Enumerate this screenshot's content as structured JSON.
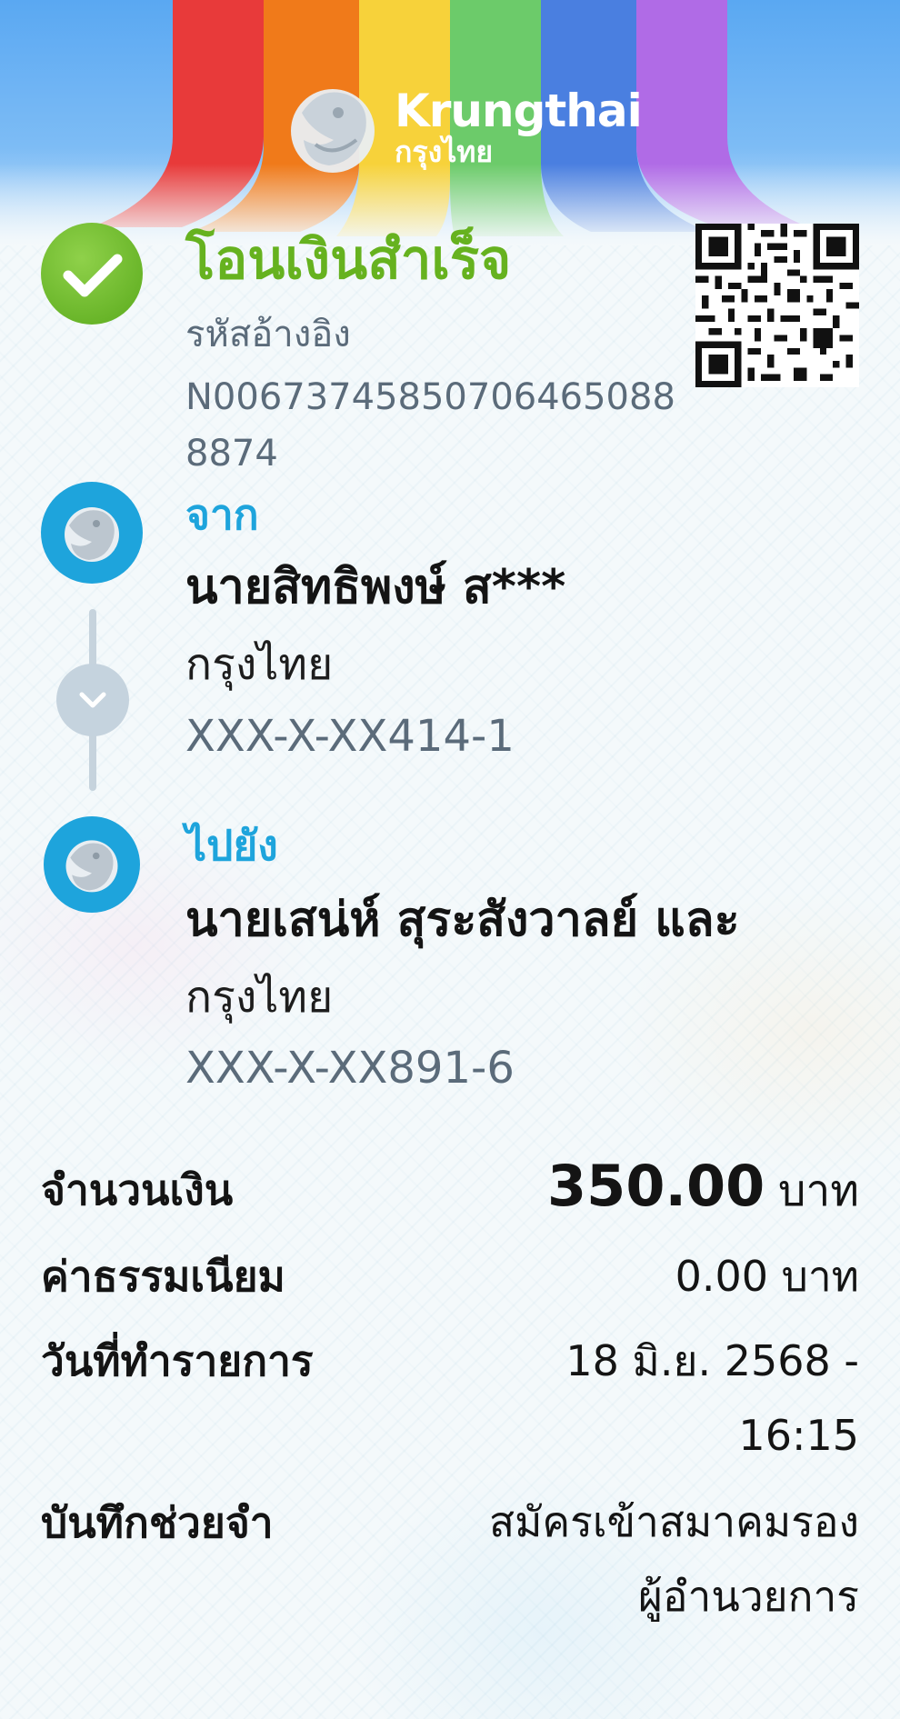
{
  "brand": {
    "name_en": "Krungthai",
    "name_th": "กรุงไทย"
  },
  "status": {
    "title": "โอนเงินสำเร็จ",
    "ref_label": "รหัสอ้างอิง",
    "ref_number": "N006737458507064650888874"
  },
  "from": {
    "label": "จาก",
    "name": "นายสิทธิพงษ์ ส***",
    "bank": "กรุงไทย",
    "account": "XXX-X-XX414-1"
  },
  "to": {
    "label": "ไปยัง",
    "name": "นายเสน่ห์ สุระสังวาลย์ และ",
    "bank": "กรุงไทย",
    "account": "XXX-X-XX891-6"
  },
  "details": {
    "amount_label": "จำนวนเงิน",
    "amount_value": "350.00",
    "amount_unit": "บาท",
    "fee_label": "ค่าธรรมเนียม",
    "fee_value": "0.00 บาท",
    "date_label": "วันที่ทำรายการ",
    "date_value": "18 มิ.ย. 2568 -",
    "time_value": "16:15",
    "memo_label": "บันทึกช่วยจำ",
    "memo_line1": "สมัครเข้าสมาคมรอง",
    "memo_line2": "ผู้อำนวยการ"
  },
  "colors": {
    "success_green": "#66b21f",
    "accent_blue": "#1ea4dc",
    "muted_text": "#5b6b7a",
    "rainbow": [
      "#e83a3a",
      "#f07a1a",
      "#f7d23a",
      "#6ccb6a",
      "#4a7fe0",
      "#b06be6"
    ]
  },
  "icons": {
    "status": "check-circle-icon",
    "avatar": "krungthai-bird-icon",
    "connector": "chevron-down-icon",
    "qr": "qr-code-icon"
  }
}
